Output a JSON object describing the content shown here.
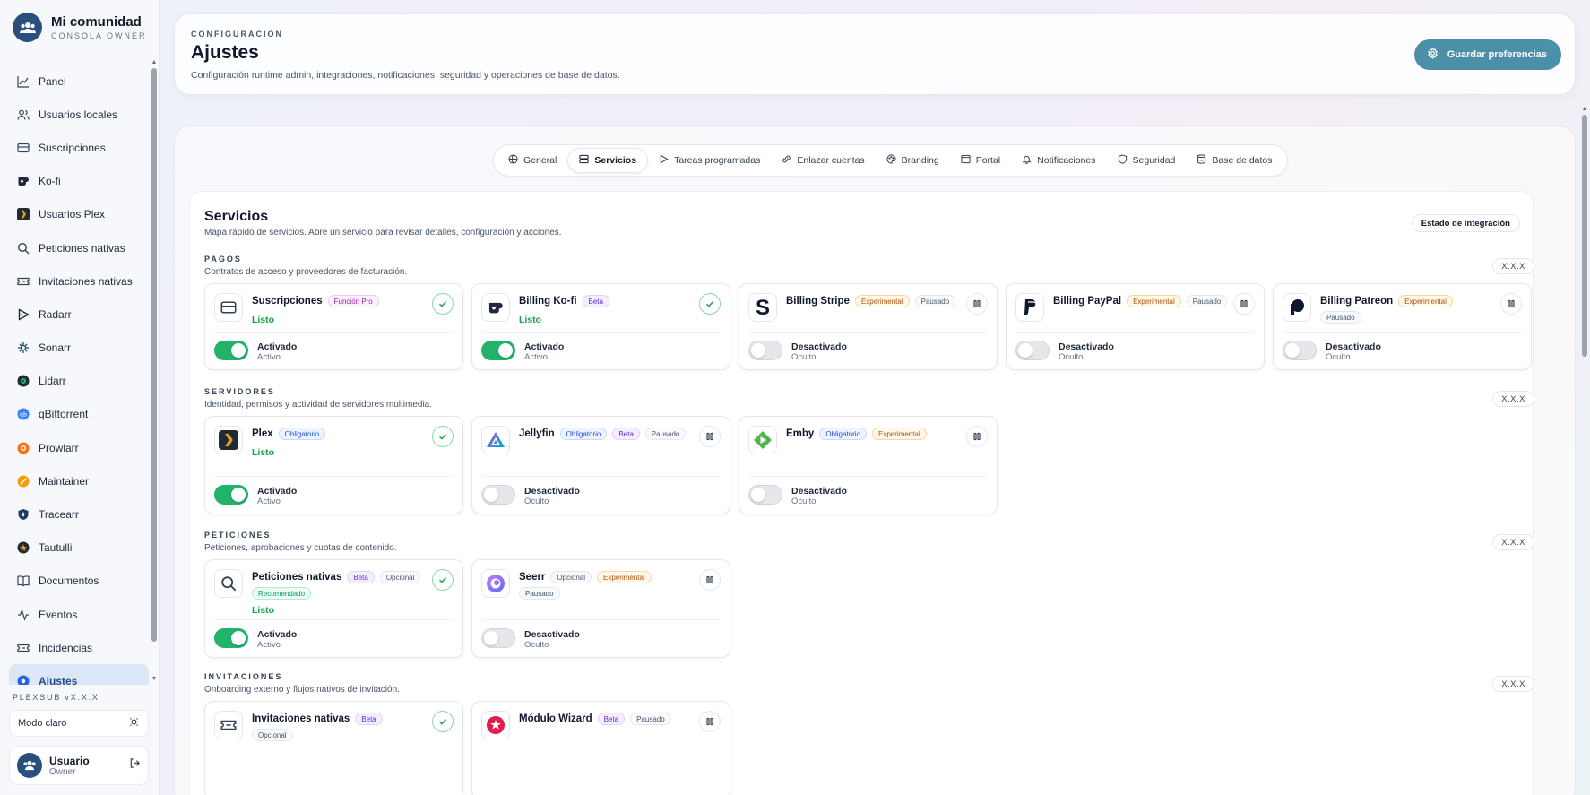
{
  "sidebar": {
    "brand_title": "Mi comunidad",
    "brand_subtitle": "CONSOLA OWNER",
    "items": [
      {
        "label": "Panel",
        "icon": "chart-line-icon"
      },
      {
        "label": "Usuarios locales",
        "icon": "users-icon"
      },
      {
        "label": "Suscripciones",
        "icon": "credit-card-icon"
      },
      {
        "label": "Ko-fi",
        "icon": "kofi-icon"
      },
      {
        "label": "Usuarios Plex",
        "icon": "plex-icon"
      },
      {
        "label": "Peticiones nativas",
        "icon": "search-icon"
      },
      {
        "label": "Invitaciones nativas",
        "icon": "ticket-icon"
      },
      {
        "label": "Radarr",
        "icon": "radarr-icon"
      },
      {
        "label": "Sonarr",
        "icon": "sonarr-icon"
      },
      {
        "label": "Lidarr",
        "icon": "lidarr-icon"
      },
      {
        "label": "qBittorrent",
        "icon": "qbittorrent-icon"
      },
      {
        "label": "Prowlarr",
        "icon": "prowlarr-icon"
      },
      {
        "label": "Maintainer",
        "icon": "maintainer-icon"
      },
      {
        "label": "Tracearr",
        "icon": "tracearr-icon"
      },
      {
        "label": "Tautulli",
        "icon": "tautulli-icon"
      },
      {
        "label": "Documentos",
        "icon": "book-icon"
      },
      {
        "label": "Eventos",
        "icon": "activity-icon"
      },
      {
        "label": "Incidencias",
        "icon": "ticket-icon"
      },
      {
        "label": "Ajustes",
        "icon": "settings-icon"
      }
    ],
    "active_index": 18,
    "version": "PLEXSUB vX.X.X",
    "theme_label": "Modo claro",
    "user_name": "Usuario",
    "user_role": "Owner"
  },
  "header": {
    "eyebrow": "CONFIGURACIÓN",
    "title": "Ajustes",
    "description": "Configuración runtime admin, integraciones, notificaciones, seguridad y operaciones de base de datos.",
    "save_label": "Guardar preferencias"
  },
  "tabs": [
    {
      "label": "General",
      "icon": "globe-icon"
    },
    {
      "label": "Servicios",
      "icon": "server-icon"
    },
    {
      "label": "Tareas programadas",
      "icon": "play-icon"
    },
    {
      "label": "Enlazar cuentas",
      "icon": "link-icon"
    },
    {
      "label": "Branding",
      "icon": "palette-icon"
    },
    {
      "label": "Portal",
      "icon": "window-icon"
    },
    {
      "label": "Notificaciones",
      "icon": "bell-icon"
    },
    {
      "label": "Seguridad",
      "icon": "shield-icon"
    },
    {
      "label": "Base de datos",
      "icon": "database-icon"
    }
  ],
  "active_tab": 1,
  "services": {
    "title": "Servicios",
    "description": "Mapa rápido de servicios. Abre un servicio para revisar detalles, configuración y acciones.",
    "integration_label": "Estado de integración",
    "sections": [
      {
        "label": "PAGOS",
        "description": "Contratos de acceso y proveedores de facturación.",
        "version": "X.X.X",
        "cards": [
          {
            "name": "Suscripciones",
            "icon": "credit-card-icon",
            "badges": [
              {
                "text": "Función Pro",
                "kind": "pro"
              }
            ],
            "status": "Listo",
            "state": "ok",
            "enabled": true,
            "toggle_label": "Activado",
            "toggle_sub": "Activo"
          },
          {
            "name": "Billing Ko-fi",
            "icon": "kofi-icon",
            "badges": [
              {
                "text": "Beta",
                "kind": "beta"
              }
            ],
            "status": "Listo",
            "state": "ok",
            "enabled": true,
            "toggle_label": "Activado",
            "toggle_sub": "Activo"
          },
          {
            "name": "Billing Stripe",
            "icon": "stripe-icon",
            "badges": [
              {
                "text": "Experimental",
                "kind": "exp"
              },
              {
                "text": "Pausado",
                "kind": "paused"
              }
            ],
            "status": "",
            "state": "paused",
            "enabled": false,
            "toggle_label": "Desactivado",
            "toggle_sub": "Oculto"
          },
          {
            "name": "Billing PayPal",
            "icon": "paypal-icon",
            "badges": [
              {
                "text": "Experimental",
                "kind": "exp"
              },
              {
                "text": "Pausado",
                "kind": "paused"
              }
            ],
            "status": "",
            "state": "paused",
            "enabled": false,
            "toggle_label": "Desactivado",
            "toggle_sub": "Oculto"
          },
          {
            "name": "Billing Patreon",
            "icon": "patreon-icon",
            "badges": [
              {
                "text": "Experimental",
                "kind": "exp"
              },
              {
                "text": "Pausado",
                "kind": "paused"
              }
            ],
            "status": "",
            "state": "paused",
            "enabled": false,
            "toggle_label": "Desactivado",
            "toggle_sub": "Oculto"
          }
        ]
      },
      {
        "label": "SERVIDORES",
        "description": "Identidad, permisos y actividad de servidores multimedia.",
        "version": "X.X.X",
        "cards": [
          {
            "name": "Plex",
            "icon": "plex-icon",
            "badges": [
              {
                "text": "Obligatorio",
                "kind": "req"
              }
            ],
            "status": "Listo",
            "state": "ok",
            "enabled": true,
            "toggle_label": "Activado",
            "toggle_sub": "Activo"
          },
          {
            "name": "Jellyfin",
            "icon": "jellyfin-icon",
            "badges": [
              {
                "text": "Obligatorio",
                "kind": "req"
              },
              {
                "text": "Beta",
                "kind": "beta"
              },
              {
                "text": "Pausado",
                "kind": "paused"
              }
            ],
            "status": "",
            "state": "paused",
            "enabled": false,
            "toggle_label": "Desactivado",
            "toggle_sub": "Oculto"
          },
          {
            "name": "Emby",
            "icon": "emby-icon",
            "badges": [
              {
                "text": "Obligatorio",
                "kind": "req"
              },
              {
                "text": "Experimental",
                "kind": "exp"
              }
            ],
            "status": "",
            "state": "paused",
            "enabled": false,
            "toggle_label": "Desactivado",
            "toggle_sub": "Oculto"
          }
        ]
      },
      {
        "label": "PETICIONES",
        "description": "Peticiones, aprobaciones y cuotas de contenido.",
        "version": "X.X.X",
        "cards": [
          {
            "name": "Peticiones nativas",
            "icon": "search-icon",
            "badges": [
              {
                "text": "Beta",
                "kind": "beta"
              },
              {
                "text": "Opcional",
                "kind": "opt"
              },
              {
                "text": "Recomendado",
                "kind": "rec"
              }
            ],
            "status": "Listo",
            "state": "ok",
            "enabled": true,
            "toggle_label": "Activado",
            "toggle_sub": "Activo"
          },
          {
            "name": "Seerr",
            "icon": "seerr-icon",
            "badges": [
              {
                "text": "Opcional",
                "kind": "opt"
              },
              {
                "text": "Experimental",
                "kind": "exp"
              },
              {
                "text": "Pausado",
                "kind": "paused"
              }
            ],
            "status": "",
            "state": "paused",
            "enabled": false,
            "toggle_label": "Desactivado",
            "toggle_sub": "Oculto"
          }
        ]
      },
      {
        "label": "INVITACIONES",
        "description": "Onboarding externo y flujos nativos de invitación.",
        "version": "X.X.X",
        "cards": [
          {
            "name": "Invitaciones nativas",
            "icon": "ticket-icon",
            "badges": [
              {
                "text": "Beta",
                "kind": "beta"
              },
              {
                "text": "Opcional",
                "kind": "opt"
              }
            ],
            "status": "",
            "state": "ok",
            "enabled": true,
            "toggle_label": "",
            "toggle_sub": ""
          },
          {
            "name": "Módulo Wizard",
            "icon": "wizard-icon",
            "badges": [
              {
                "text": "Beta",
                "kind": "beta"
              },
              {
                "text": "Pausado",
                "kind": "paused"
              }
            ],
            "status": "",
            "state": "paused",
            "enabled": false,
            "toggle_label": "",
            "toggle_sub": ""
          }
        ]
      }
    ]
  },
  "colors": {
    "accent": "#4b8fa8",
    "brand": "#2a4f7c",
    "success": "#22b36b",
    "status_text": "#16a34a"
  }
}
